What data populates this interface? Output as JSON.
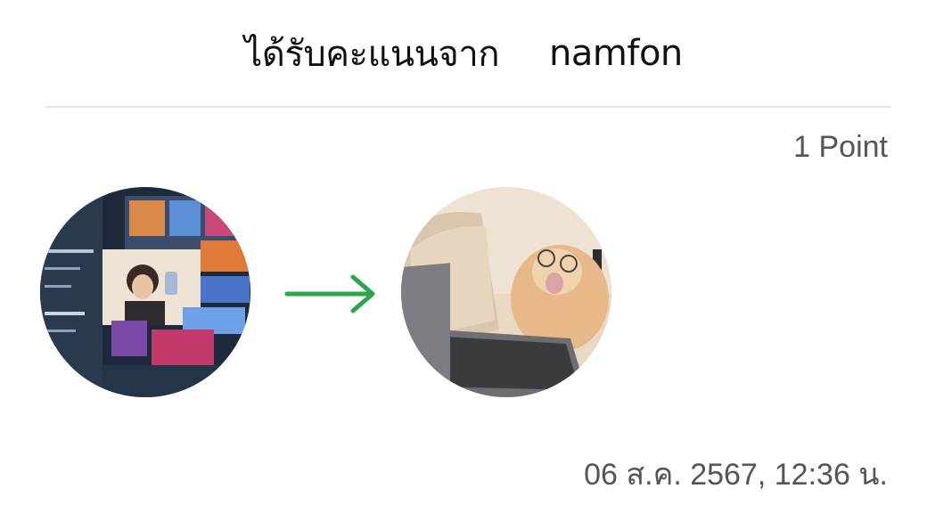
{
  "header": {
    "title": "ได้รับคะแนนจาก",
    "sender_name": "namfon"
  },
  "points_label": "1 Point",
  "transfer": {
    "from_avatar_icon": "avatar-photo-girl-with-phone",
    "arrow_icon": "arrow-right-icon",
    "to_avatar_icon": "avatar-photo-cat-on-laptop",
    "arrow_color": "#2ea44f"
  },
  "timestamp": "06 ส.ค. 2567, 12:36 น."
}
